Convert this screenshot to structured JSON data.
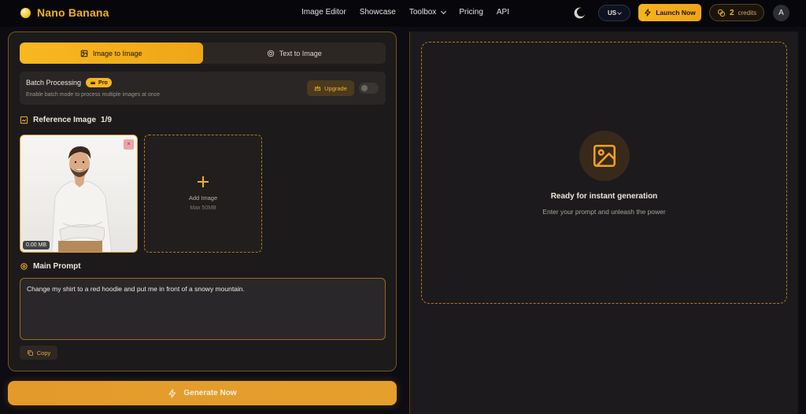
{
  "brand": {
    "name": "Nano Banana"
  },
  "nav": {
    "links": [
      "Image Editor",
      "Showcase",
      "Toolbox",
      "Pricing",
      "API"
    ],
    "language": "US",
    "launch_label": "Launch Now",
    "credits_count": "2",
    "credits_label": "credits",
    "avatar_initial": "A"
  },
  "mode_tabs": {
    "image_to_image": "Image to Image",
    "text_to_image": "Text to Image",
    "active": "image_to_image"
  },
  "batch": {
    "title": "Batch Processing",
    "badge": "Pro",
    "description": "Enable batch mode to process multiple images at once",
    "upgrade_label": "Upgrade",
    "enabled": false
  },
  "reference": {
    "label": "Reference Image",
    "count": "1/9",
    "file_size": "0.00 MB",
    "add_label": "Add Image",
    "add_limit": "Max 50MB"
  },
  "prompt": {
    "label": "Main Prompt",
    "value": "Change my shirt to a red hoodie and put me in front of a snowy mountain.",
    "copy_label": "Copy"
  },
  "generate_label": "Generate Now",
  "preview": {
    "title": "Ready for instant generation",
    "subtitle": "Enter your prompt and unleash the power"
  },
  "colors": {
    "accent": "#f6b41c",
    "background": "#0d0c12",
    "panel": "#1c1a1b",
    "border": "#7a5418"
  },
  "icons": [
    "sun-icon",
    "chevron-down-icon",
    "moon-icon",
    "bolt-icon",
    "coins-icon",
    "image-icon",
    "sparkle-icon",
    "crown-icon",
    "photo-stack-icon",
    "settings-icon",
    "copy-icon",
    "plus-icon",
    "close-icon"
  ]
}
